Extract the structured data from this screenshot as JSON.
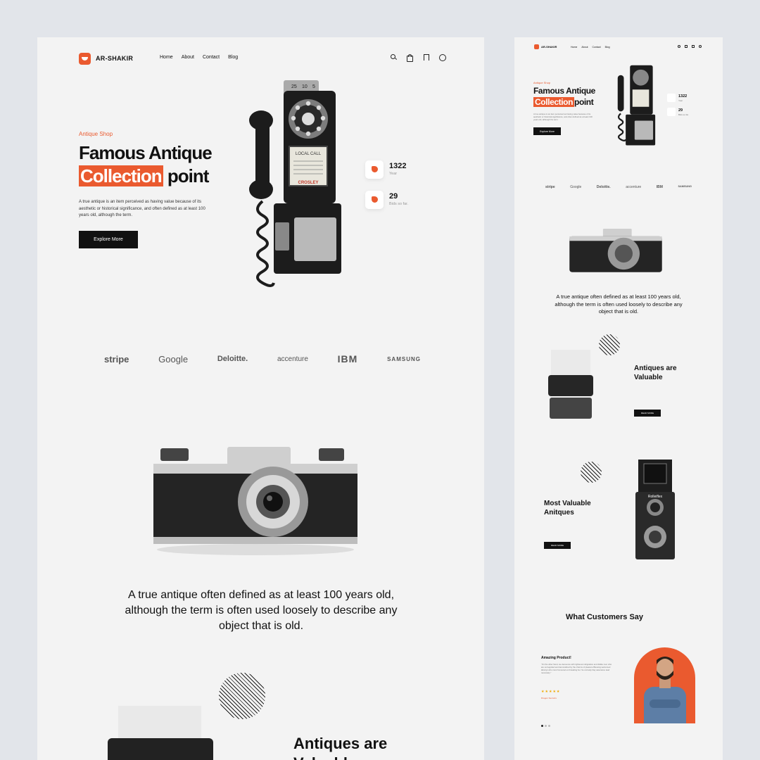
{
  "brand": {
    "name": "AR-SHAKIR"
  },
  "nav": {
    "links": [
      "Home",
      "About",
      "Contact",
      "Blog"
    ]
  },
  "hero": {
    "tag": "Antique Shop",
    "title_line1": "Famous Antique",
    "title_highlight": "Collection",
    "title_rest": "point",
    "description": "A true antique is an item perceived as having value because of its aesthetic or historical significance, and often defined as at least 100 years old, although the term.",
    "button": "Explore More"
  },
  "stats": [
    {
      "value": "1322",
      "label": "Year"
    },
    {
      "value": "29",
      "label": "Bids so far."
    }
  ],
  "phone": {
    "dial_labels": [
      "25",
      "10",
      "5"
    ],
    "card_title": "LOCAL CALL",
    "card_brand": "CROSLEY"
  },
  "logos": [
    "stripe",
    "Google",
    "Deloitte.",
    "accenture",
    "IBM",
    "SAMSUNG"
  ],
  "quote": "A true antique often defined as at least 100 years old, although the term is often used loosely to describe any object that is old.",
  "section1": {
    "title_line1": "Antiques are",
    "title_line2": "Valuable",
    "button": "READ MORE"
  },
  "section2": {
    "title_line1": "Most Valuable",
    "title_line2": "Anitques",
    "button": "READ MORE",
    "camera_brand": "Rolleiflex"
  },
  "testimonials": {
    "title": "What Customers Say",
    "item_title": "Amazing Product!",
    "item_text": "“On the other hand, we denounce with righteous indignation and dislike men who are so beguiled and demoralized by the charms of pleasure Blessing welcomed laboriys who must honoured ext breaking her. So curiosity Day assurance lead necessary.”",
    "stars": "★★★★★",
    "author": "Dragon Sentorts"
  },
  "colors": {
    "accent": "#ea5a2f",
    "page": "#f3f3f3",
    "backdrop": "#e2e5ea",
    "dark": "#111111"
  },
  "icons": [
    "search-icon",
    "bag-icon",
    "bookmark-icon",
    "whatsapp-icon"
  ]
}
